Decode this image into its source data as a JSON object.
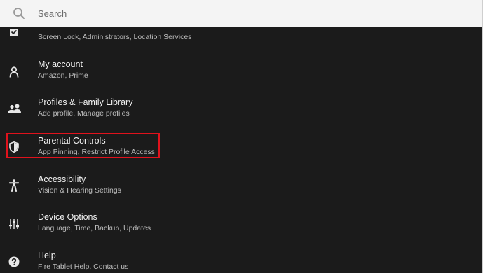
{
  "search": {
    "placeholder": "Search"
  },
  "settings": {
    "security": {
      "subtitle": "Screen Lock, Administrators, Location Services",
      "icon": "checkbox-icon"
    },
    "my_account": {
      "title": "My account",
      "subtitle": "Amazon, Prime",
      "icon": "person-icon"
    },
    "profiles": {
      "title": "Profiles & Family Library",
      "subtitle": "Add profile, Manage profiles",
      "icon": "people-icon"
    },
    "parental_controls": {
      "title": "Parental Controls",
      "subtitle": "App Pinning, Restrict Profile Access",
      "icon": "shield-icon"
    },
    "accessibility": {
      "title": "Accessibility",
      "subtitle": "Vision & Hearing Settings",
      "icon": "accessibility-icon"
    },
    "device_options": {
      "title": "Device Options",
      "subtitle": "Language, Time, Backup, Updates",
      "icon": "sliders-icon"
    },
    "help": {
      "title": "Help",
      "subtitle": "Fire Tablet Help, Contact us",
      "icon": "help-icon"
    }
  },
  "colors": {
    "background": "#1b1b1b",
    "search_bar": "#f4f4f4",
    "title_text": "#f2f2f2",
    "subtitle_text": "#bdbdbd",
    "highlight": "#e0121c"
  }
}
